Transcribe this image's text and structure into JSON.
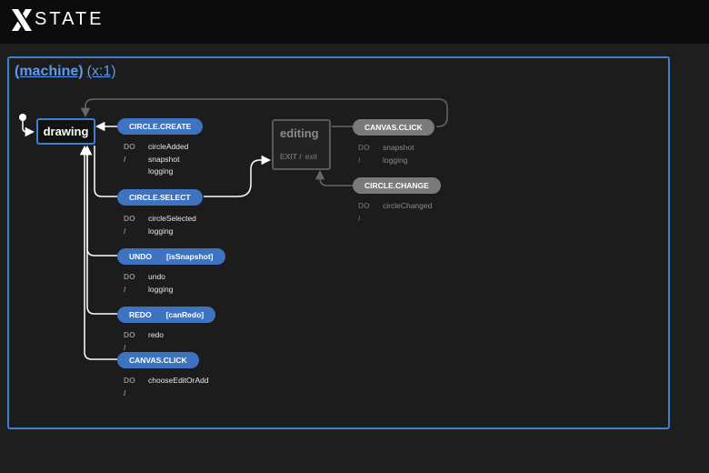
{
  "header": {
    "logo_text": "STATE",
    "logo_icon": "xstate-x-icon"
  },
  "machine": {
    "title": "(machine)",
    "key": "(x:1)"
  },
  "states": {
    "drawing": {
      "label": "drawing"
    },
    "editing": {
      "label": "editing",
      "exit_label": "EXIT /",
      "exit_action": "exit"
    }
  },
  "transitions": [
    {
      "event": "CIRCLE.CREATE",
      "guard": "",
      "do_label": "DO /",
      "actions": [
        "circleAdded",
        "snapshot",
        "logging"
      ]
    },
    {
      "event": "CIRCLE.SELECT",
      "guard": "",
      "do_label": "DO /",
      "actions": [
        "circleSelected",
        "logging"
      ]
    },
    {
      "event": "UNDO",
      "guard": "[isSnapshot]",
      "do_label": "DO /",
      "actions": [
        "undo",
        "logging"
      ]
    },
    {
      "event": "REDO",
      "guard": "[canRedo]",
      "do_label": "DO /",
      "actions": [
        "redo"
      ]
    },
    {
      "event": "CANVAS.CLICK",
      "guard": "",
      "do_label": "DO /",
      "actions": [
        "chooseEditOrAdd"
      ]
    },
    {
      "event": "CANVAS.CLICK",
      "guard": "",
      "do_label": "DO /",
      "actions": [
        "snapshot",
        "logging"
      ]
    },
    {
      "event": "CIRCLE.CHANGE",
      "guard": "",
      "do_label": "DO /",
      "actions": [
        "circleChanged"
      ]
    }
  ],
  "colors": {
    "accent": "#3e7fd6",
    "pill_active": "#3e73c2",
    "pill_inactive": "#7a7a7a",
    "background": "#1e1e1e"
  }
}
